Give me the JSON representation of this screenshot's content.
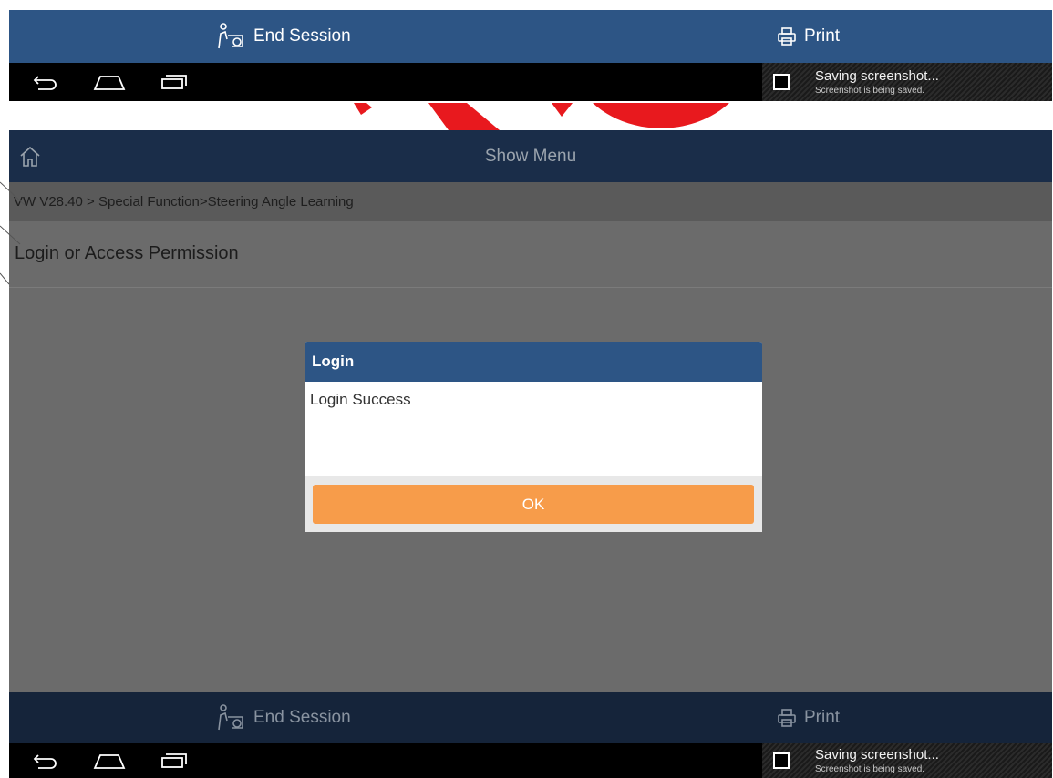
{
  "top_actions": {
    "end_session": "End Session",
    "print": "Print"
  },
  "system": {
    "notification_title": "Saving screenshot...",
    "notification_subtitle": "Screenshot is being saved."
  },
  "header": {
    "title": "Show Menu"
  },
  "breadcrumb": "VW V28.40 > Special Function>Steering Angle Learning",
  "section": {
    "title": "Login or Access Permission"
  },
  "dialog": {
    "title": "Login",
    "message": "Login Success",
    "ok_label": "OK"
  },
  "bottom_actions": {
    "end_session": "End Session",
    "print": "Print"
  },
  "colors": {
    "action_bar": "#2d5585",
    "header": "#1a2d49",
    "ok_button": "#f79c4a",
    "watermark": "#e8191e"
  }
}
